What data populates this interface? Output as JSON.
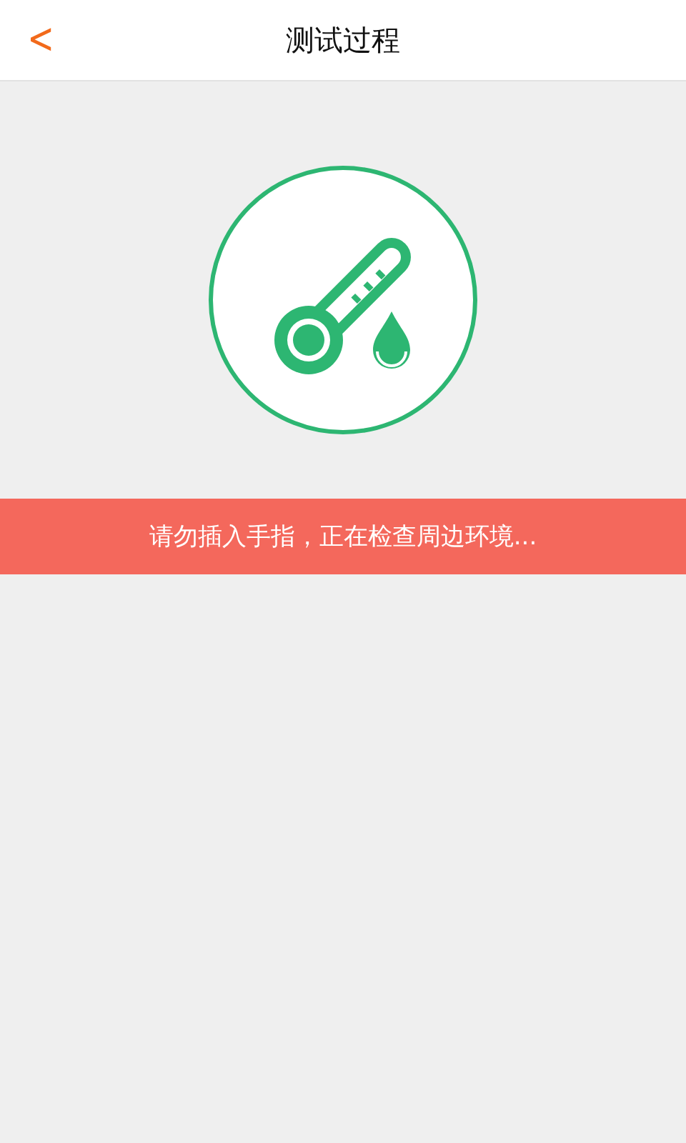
{
  "header": {
    "back": "<",
    "title": "测试过程"
  },
  "status": {
    "message": "请勿插入手指，正在检查周边环境..."
  }
}
